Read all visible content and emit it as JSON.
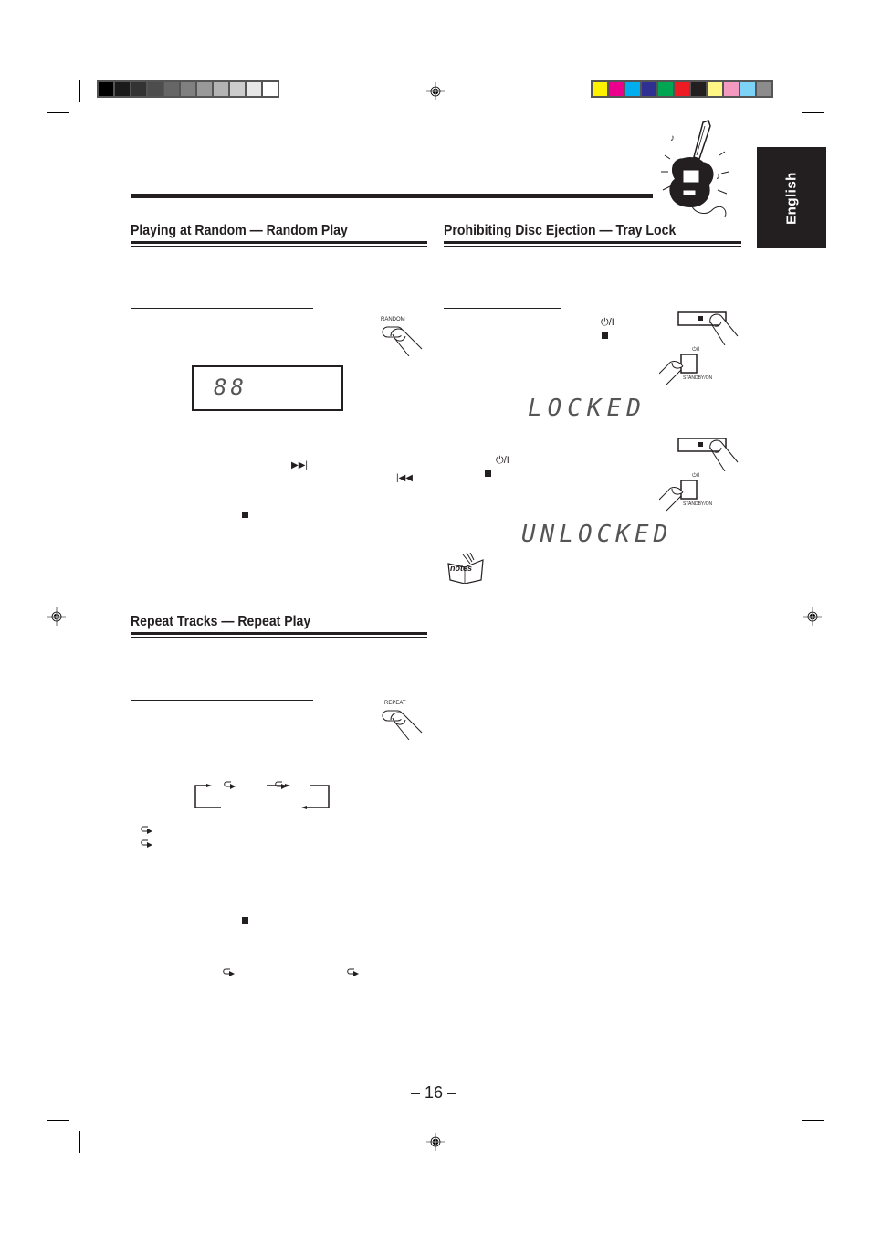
{
  "color_bars": {
    "grayscale": [
      "#000000",
      "#1a1a1a",
      "#333333",
      "#4d4d4d",
      "#666666",
      "#808080",
      "#999999",
      "#b3b3b3",
      "#cccccc",
      "#e6e6e6",
      "#ffffff"
    ],
    "process": [
      "#fff200",
      "#ec008c",
      "#00aeef",
      "#2e3192",
      "#00a651",
      "#ed1c24",
      "#231f20",
      "#fff685",
      "#f49ac1",
      "#7dd3f7",
      "#8c8c8c"
    ]
  },
  "language_tab": "English",
  "sections": {
    "random": {
      "title": "Playing at Random — Random Play",
      "button_label": "RANDOM",
      "display_digits": "88",
      "next_icon": "▶▶|",
      "prev_icon": "|◀◀",
      "stop_icon": "■"
    },
    "tray_lock": {
      "title": "Prohibiting Disc Ejection — Tray Lock",
      "power_symbol": "⏻/I",
      "stop_icon": "■",
      "standby_label": "STANDBY/ON",
      "locked_display": "LOCKED",
      "unlocked_display": "UNLOCKED",
      "notes_label": "notes"
    },
    "repeat": {
      "title": "Repeat Tracks — Repeat Play",
      "button_label": "REPEAT",
      "stop_icon": "■"
    }
  },
  "page_number": "– 16 –"
}
